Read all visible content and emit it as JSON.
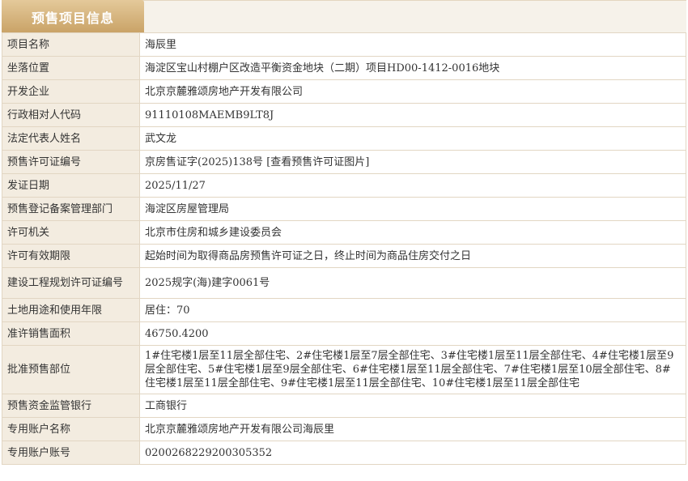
{
  "tab": {
    "title": "预售项目信息"
  },
  "rows": [
    {
      "label": "项目名称",
      "value": "海辰里"
    },
    {
      "label": "坐落位置",
      "value": "海淀区宝山村棚户区改造平衡资金地块（二期）项目HD00-1412-0016地块"
    },
    {
      "label": "开发企业",
      "value": "北京京麓雅颂房地产开发有限公司"
    },
    {
      "label": "行政相对人代码",
      "value": "91110108MAEMB9LT8J"
    },
    {
      "label": "法定代表人姓名",
      "value": "武文龙"
    },
    {
      "label": "预售许可证编号",
      "value": "京房售证字(2025)138号",
      "link": "[查看预售许可证图片]"
    },
    {
      "label": "发证日期",
      "value": "2025/11/27"
    },
    {
      "label": "预售登记备案管理部门",
      "value": "海淀区房屋管理局"
    },
    {
      "label": "许可机关",
      "value": "北京市住房和城乡建设委员会"
    },
    {
      "label": "许可有效期限",
      "value": "起始时间为取得商品房预售许可证之日，终止时间为商品住房交付之日"
    },
    {
      "label": "建设工程规划许可证编号",
      "value": "2025规字(海)建字0061号"
    },
    {
      "label": "土地用途和使用年限",
      "value": "居住：70"
    },
    {
      "label": "准许销售面积",
      "value": "46750.4200"
    },
    {
      "label": "批准预售部位",
      "value": "1#住宅楼1层至11层全部住宅、2#住宅楼1层至7层全部住宅、3#住宅楼1层至11层全部住宅、4#住宅楼1层至9层全部住宅、5#住宅楼1层至9层全部住宅、6#住宅楼1层至11层全部住宅、7#住宅楼1层至10层全部住宅、8#住宅楼1层至11层全部住宅、9#住宅楼1层至11层全部住宅、10#住宅楼1层至11层全部住宅"
    },
    {
      "label": "预售资金监管银行",
      "value": "工商银行"
    },
    {
      "label": "专用账户名称",
      "value": "北京京麓雅颂房地产开发有限公司海辰里"
    },
    {
      "label": "专用账户账号",
      "value": "0200268229200305352"
    }
  ]
}
